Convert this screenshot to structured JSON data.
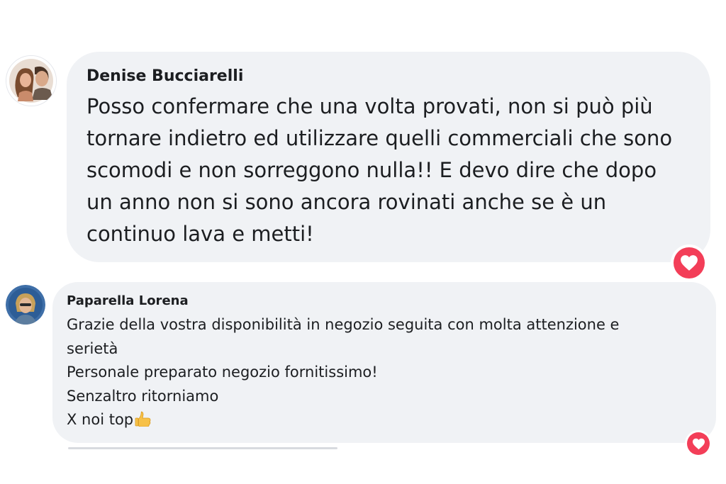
{
  "comments": [
    {
      "author": "Denise Bucciarelli",
      "lines": [
        "Posso confermare che una volta provati, non si può più",
        "tornare indietro ed utilizzare quelli commerciali che sono",
        "scomodi e non sorreggono nulla!! E devo dire che dopo",
        "un anno non si sono ancora rovinati anche se è un",
        "continuo lava e metti!"
      ],
      "reaction_icon": "heart-icon"
    },
    {
      "author": "Paparella Lorena",
      "lines": [
        "Grazie della vostra disponibilità in negozio seguita con molta attenzione e",
        "serietà",
        "Personale preparato negozio fornitissimo!",
        "Senzaltro ritorniamo",
        "X noi top"
      ],
      "last_line_emoji": "thumbs-up-icon",
      "reaction_icon": "heart-icon"
    }
  ],
  "colors": {
    "bubble": "#f0f2f5",
    "text": "#1c1e21",
    "heart": "#f33e58"
  }
}
